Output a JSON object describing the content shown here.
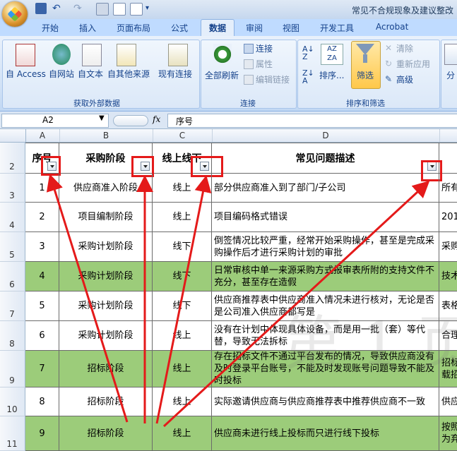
{
  "title_bar": {
    "title": "常见不合规现象及建议整改"
  },
  "ribbon_tabs": [
    "开始",
    "插入",
    "页面布局",
    "公式",
    "数据",
    "审阅",
    "视图",
    "开发工具",
    "Acrobat"
  ],
  "active_tab": "数据",
  "ribbon": {
    "get_external_data": {
      "label": "获取外部数据",
      "buttons": [
        "自 Access",
        "自网站",
        "自文本",
        "自其他来源",
        "现有连接"
      ]
    },
    "connections": {
      "label": "连接",
      "refresh_all": "全部刷新",
      "items": [
        "连接",
        "属性",
        "编辑链接"
      ]
    },
    "sort_filter": {
      "label": "排序和筛选",
      "sort": "排序...",
      "filter": "筛选",
      "items": [
        "清除",
        "重新应用",
        "高级"
      ]
    },
    "partial_label": "分"
  },
  "formula_bar": {
    "name_box": "A2",
    "fx": "fx",
    "value": "序号"
  },
  "columns": [
    "A",
    "B",
    "C",
    "D"
  ],
  "headers": [
    "序号",
    "采购阶段",
    "线上线下",
    "常见问题描述"
  ],
  "rows": [
    {
      "row": "3",
      "no": "1",
      "stage": "供应商准入阶段",
      "mode": "线上",
      "desc": "部分供应商准入到了部门/子公司",
      "extra": "所有",
      "green": false
    },
    {
      "row": "4",
      "no": "2",
      "stage": "项目编制阶段",
      "mode": "线上",
      "desc": "项目编码格式错误",
      "extra": "201",
      "green": false
    },
    {
      "row": "5",
      "no": "3",
      "stage": "采购计划阶段",
      "mode": "线下",
      "desc": "倒签情况比较严重，经常开始采购操作，甚至是完成采购操作后才进行采购计划的审批",
      "extra": "采购",
      "green": false
    },
    {
      "row": "6",
      "no": "4",
      "stage": "采购计划阶段",
      "mode": "线下",
      "desc": "日常审核中单一来源采购方式报审表所附的支持文件不充分，甚至存在造假",
      "extra": "技术",
      "green": true
    },
    {
      "row": "7",
      "no": "5",
      "stage": "采购计划阶段",
      "mode": "线下",
      "desc": "供应商推荐表中供应商准入情况未进行核对，无论是否是公司准入供应商都写是",
      "extra": "表格",
      "green": false
    },
    {
      "row": "8",
      "no": "6",
      "stage": "采购计划阶段",
      "mode": "线上",
      "desc": "没有在计划中体现具体设备，而是用一批（套）等代替，导致无法拆标",
      "extra": "合理",
      "green": false
    },
    {
      "row": "9",
      "no": "7",
      "stage": "招标阶段",
      "mode": "线上",
      "desc": "存在招标文件不通过平台发布的情况，导致供应商没有及时登录平台账号，不能及时发现账号问题导致不能及时投标",
      "extra": "招标\n载招",
      "green": true
    },
    {
      "row": "10",
      "no": "8",
      "stage": "招标阶段",
      "mode": "线上",
      "desc": "实际邀请供应商与供应商推荐表中推荐供应商不一致",
      "extra": "供应",
      "green": false
    },
    {
      "row": "11",
      "no": "9",
      "stage": "招标阶段",
      "mode": "线上",
      "desc": "供应商未进行线上投标而只进行线下投标",
      "extra": "按照\n为弃",
      "green": true
    }
  ],
  "watermark": "第 1 页"
}
